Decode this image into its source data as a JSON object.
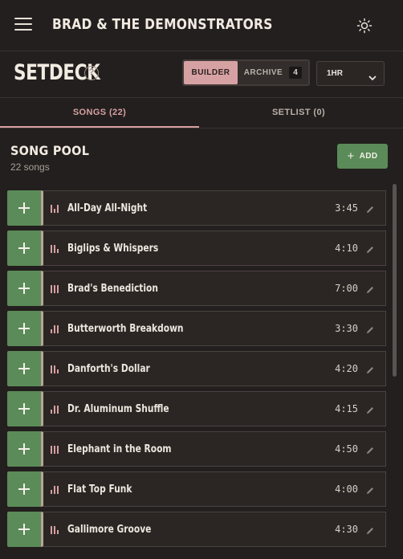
{
  "topbar": {
    "band_name": "BRAD & THE DEMONSTRATORS",
    "menu_icon": "hamburger-menu-icon",
    "theme_icon": "sun-icon"
  },
  "header": {
    "app_title": "SETDECK",
    "help_icon": "help-circle-icon",
    "mode_builder": "BUILDER",
    "mode_archive": "ARCHIVE",
    "archive_count": "4",
    "duration_value": "1HR"
  },
  "tabs": {
    "songs": "SONGS (22)",
    "setlist": "SETLIST (0)"
  },
  "pool": {
    "title": "SONG POOL",
    "count": "22 songs",
    "add_label": "ADD"
  },
  "songs": [
    {
      "title": "All-Day All-Night",
      "duration": "3:45",
      "energy": [
        1,
        0.5,
        1
      ]
    },
    {
      "title": "Biglips & Whispers",
      "duration": "4:10",
      "energy": [
        1,
        1,
        0.5
      ]
    },
    {
      "title": "Brad's Benediction",
      "duration": "7:00",
      "energy": [
        1,
        1,
        1
      ]
    },
    {
      "title": "Butterworth Breakdown",
      "duration": "3:30",
      "energy": [
        0.5,
        1,
        1
      ]
    },
    {
      "title": "Danforth's Dollar",
      "duration": "4:20",
      "energy": [
        1,
        1,
        0.5
      ]
    },
    {
      "title": "Dr. Aluminum Shuffle",
      "duration": "4:15",
      "energy": [
        0.5,
        1,
        1
      ]
    },
    {
      "title": "Elephant in the Room",
      "duration": "4:50",
      "energy": [
        1,
        1,
        1
      ]
    },
    {
      "title": "Flat Top Funk",
      "duration": "4:00",
      "energy": [
        0.5,
        1,
        1
      ]
    },
    {
      "title": "Gallimore Groove",
      "duration": "4:30",
      "energy": [
        1,
        1,
        0.5
      ]
    }
  ],
  "colors": {
    "background": "#231f1e",
    "accent_pink": "#d6a1a2",
    "accent_green": "#5b8b58"
  }
}
